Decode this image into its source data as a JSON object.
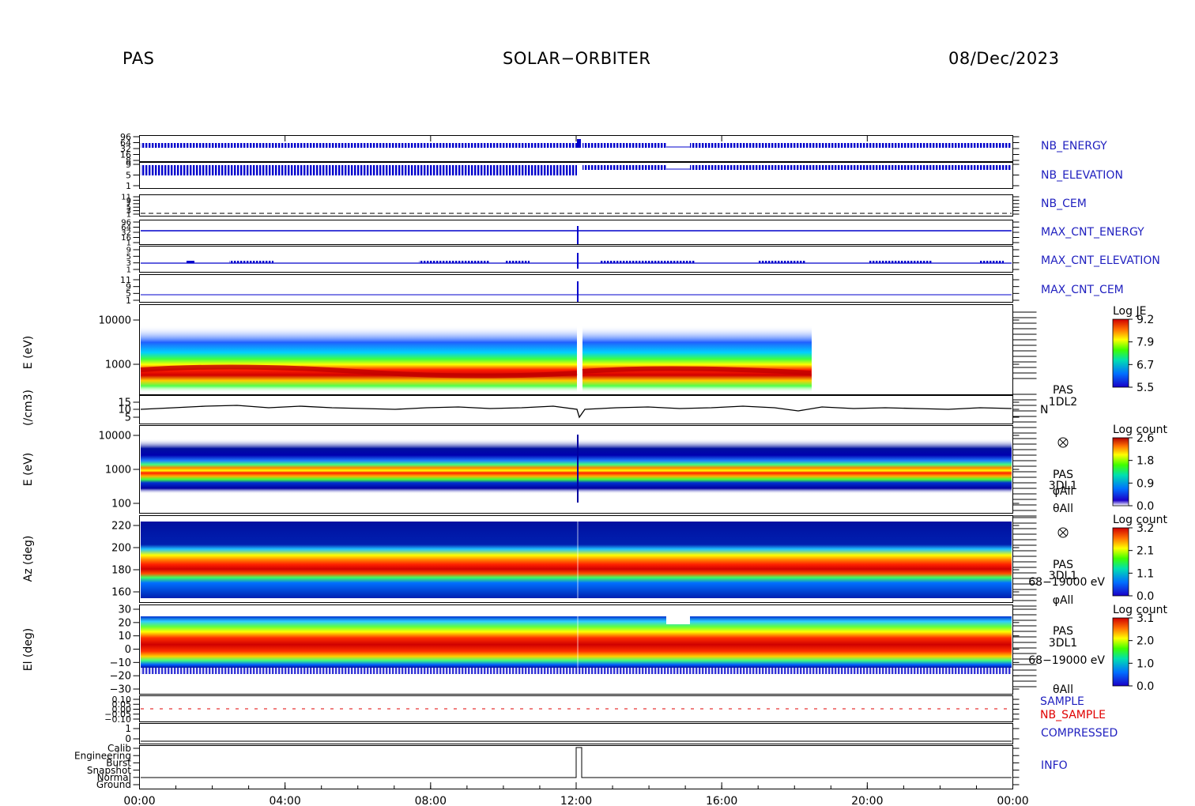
{
  "header": {
    "left": "PAS",
    "center": "SOLAR−ORBITER",
    "right": "08/Dec/2023"
  },
  "colors": {
    "panel_label_blue": "#1f1fbf",
    "nb_sample_red": "#e00000",
    "trace_blue": "#0000cc",
    "trace_black": "#000000"
  },
  "chart_data": [
    {
      "type": "line",
      "id": "nb-energy",
      "label": "NB_ENERGY",
      "y_ticks": [
        "96",
        "64",
        "32",
        "16",
        "8"
      ],
      "series_color": "blue"
    },
    {
      "type": "line",
      "id": "nb-elevation",
      "label": "NB_ELEVATION",
      "y_ticks": [
        "9",
        "5",
        "1"
      ],
      "series_color": "blue"
    },
    {
      "type": "line",
      "id": "nb-cem",
      "label": "NB_CEM",
      "y_ticks": [
        "11",
        "9",
        "7",
        "5",
        "3",
        "1"
      ],
      "series_color": "black"
    },
    {
      "type": "line",
      "id": "max-cnt-energy",
      "label": "MAX_CNT_ENERGY",
      "y_ticks": [
        "96",
        "64",
        "32",
        "16",
        "1"
      ],
      "series_color": "blue"
    },
    {
      "type": "line",
      "id": "max-cnt-elevation",
      "label": "MAX_CNT_ELEVATION",
      "y_ticks": [
        "9",
        "5",
        "3",
        "1"
      ],
      "series_color": "blue"
    },
    {
      "type": "line",
      "id": "max-cnt-cem",
      "label": "MAX_CNT_CEM",
      "y_ticks": [
        "11",
        "9",
        "5",
        "1"
      ],
      "series_color": "blue"
    },
    {
      "type": "heatmap",
      "id": "pas-1dl2",
      "ylabel": "E (eV)",
      "y_scale": "log",
      "y_ticks": [
        "10000",
        "1000"
      ],
      "colorbar": {
        "title": "Log JE",
        "ticks": [
          "9.2",
          "7.9",
          "6.7",
          "5.5"
        ]
      }
    },
    {
      "type": "line",
      "id": "density",
      "ylabel": "(/cm3)",
      "y_ticks": [
        "15",
        "10",
        "5"
      ],
      "side_labels": [
        "PAS",
        "1DL2",
        "N"
      ]
    },
    {
      "type": "heatmap",
      "id": "pas-3dl1-energy",
      "ylabel": "E (eV)",
      "y_scale": "log",
      "y_ticks": [
        "10000",
        "1000",
        "100"
      ],
      "colorbar": {
        "title": "Log count",
        "ticks": [
          "2.6",
          "1.8",
          "0.9",
          "0.0"
        ]
      },
      "side_labels": [
        "PAS",
        "3DL1",
        "φAll",
        "θAll"
      ]
    },
    {
      "type": "heatmap",
      "id": "pas-3dl1-azimuth",
      "ylabel": "Az (deg)",
      "y_ticks": [
        "220",
        "200",
        "180",
        "160"
      ],
      "colorbar": {
        "title": "Log count",
        "ticks": [
          "3.2",
          "2.1",
          "1.1",
          "0.0"
        ]
      },
      "side_labels": [
        "PAS",
        "3DL1",
        "68−19000 eV",
        "φAll"
      ]
    },
    {
      "type": "heatmap",
      "id": "pas-3dl1-elevation",
      "ylabel": "El (deg)",
      "y_ticks": [
        "30",
        "20",
        "10",
        "0",
        "−10",
        "−20",
        "−30"
      ],
      "colorbar": {
        "title": "Log count",
        "ticks": [
          "3.1",
          "2.0",
          "1.0",
          "0.0"
        ]
      },
      "side_labels": [
        "PAS",
        "3DL1",
        "68−19000 eV",
        "θAll"
      ]
    },
    {
      "type": "line",
      "id": "sample",
      "labels": [
        "SAMPLE",
        "NB_SAMPLE"
      ],
      "y_ticks": [
        "0.10",
        "0.05",
        "0.00",
        "−0.05",
        "−0.10"
      ]
    },
    {
      "type": "line",
      "id": "compressed",
      "label": "COMPRESSED",
      "y_ticks": [
        "1",
        "0"
      ]
    },
    {
      "type": "line",
      "id": "info",
      "label": "INFO",
      "y_ticks": [
        "Calib",
        "Engineering",
        "Burst",
        "Snapshot",
        "Normal",
        "Ground"
      ]
    }
  ],
  "x_axis": {
    "ticks": [
      "00:00",
      "04:00",
      "08:00",
      "12:00",
      "16:00",
      "20:00",
      "00:00"
    ]
  }
}
